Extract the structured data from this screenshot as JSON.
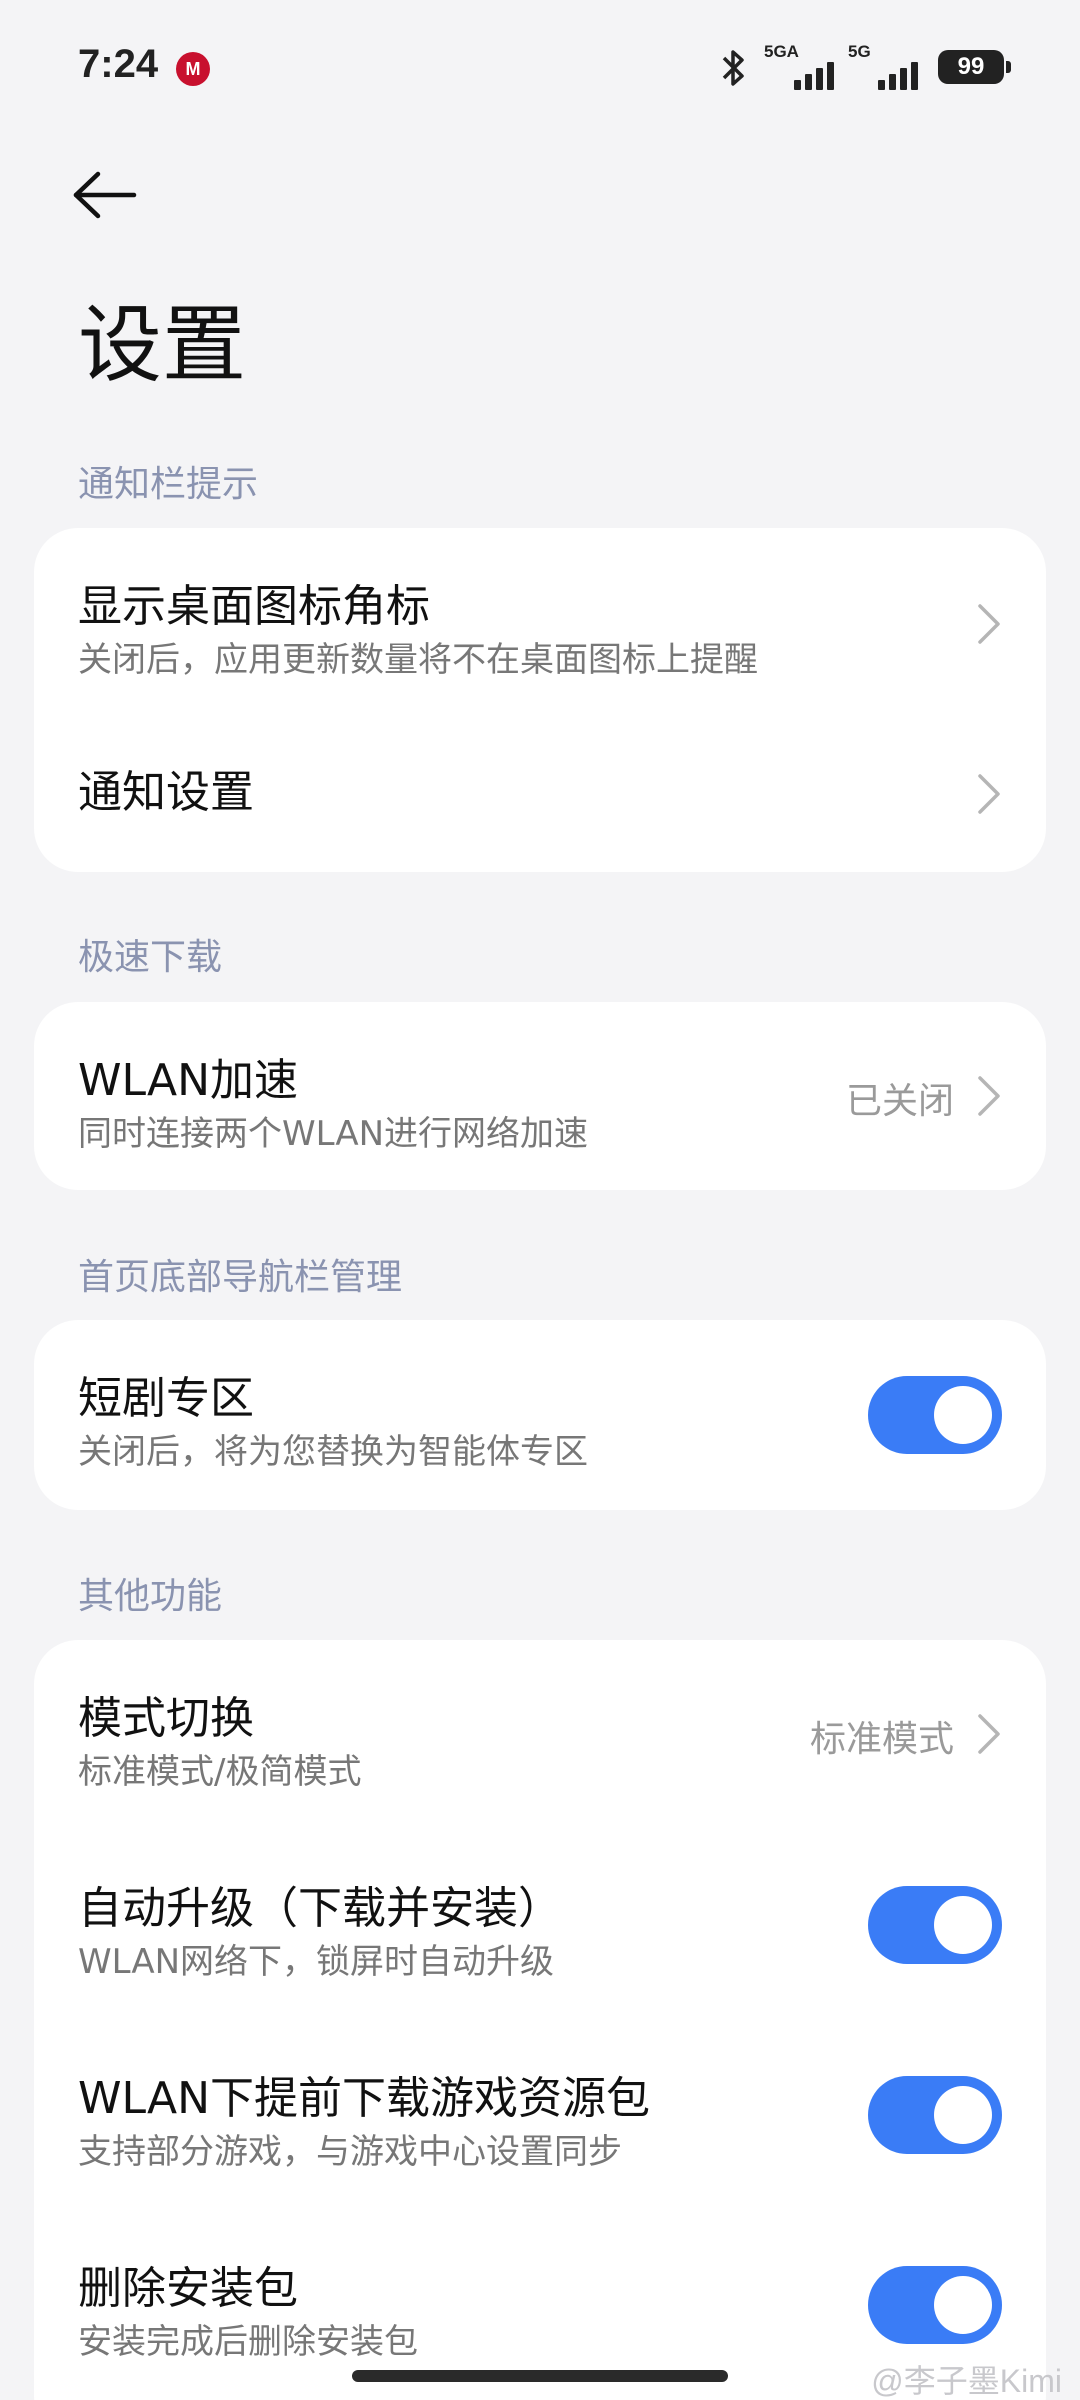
{
  "status_bar": {
    "time": "7:24",
    "brand_icon_text": "M",
    "network1": "5GA",
    "network2": "5G",
    "battery": "99"
  },
  "header": {
    "title": "设置"
  },
  "sections": {
    "notification": {
      "title": "通知栏提示",
      "badge": {
        "title": "显示桌面图标角标",
        "subtitle": "关闭后，应用更新数量将不在桌面图标上提醒"
      },
      "settings": {
        "title": "通知设置"
      }
    },
    "speed": {
      "title": "极速下载",
      "wlan": {
        "title": "WLAN加速",
        "subtitle": "同时连接两个WLAN进行网络加速",
        "value": "已关闭"
      }
    },
    "navbar": {
      "title": "首页底部导航栏管理",
      "drama": {
        "title": "短剧专区",
        "subtitle": "关闭后，将为您替换为智能体专区",
        "enabled": true
      }
    },
    "other": {
      "title": "其他功能",
      "mode": {
        "title": "模式切换",
        "subtitle": "标准模式/极简模式",
        "value": "标准模式"
      },
      "auto_upgrade": {
        "title": "自动升级（下载并安装）",
        "subtitle": "WLAN网络下，锁屏时自动升级",
        "enabled": true
      },
      "game_pack": {
        "title": "WLAN下提前下载游戏资源包",
        "subtitle": "支持部分游戏，与游戏中心设置同步",
        "enabled": true
      },
      "delete_pkg": {
        "title": "删除安装包",
        "subtitle": "安装完成后删除安装包",
        "enabled": true
      }
    }
  },
  "watermark": "@李子墨Kimi",
  "colors": {
    "accent": "#3a7cf6",
    "section_title": "#8a93b0",
    "background": "#f4f4f6"
  }
}
